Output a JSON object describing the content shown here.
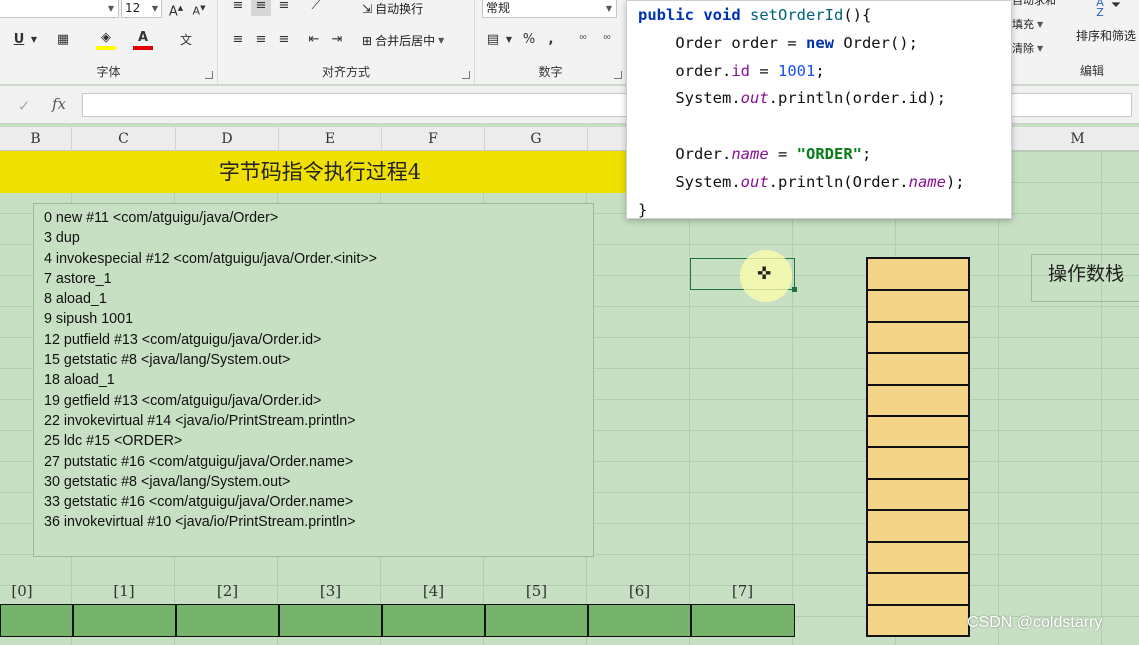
{
  "ribbon": {
    "font_size": "12",
    "font_group_label": "字体",
    "alignment_group_label": "对齐方式",
    "number_group_label": "数字",
    "editing_group_label": "编辑",
    "wrap_text_label": "自动换行",
    "merge_center_label": "合并后居中",
    "number_format": "常规",
    "percent_symbol": "%",
    "comma_symbol": ",",
    "fill_label": "填充",
    "clear_label": "清除",
    "sum_label": "自动求和",
    "sort_filter_label": "排序和筛选"
  },
  "formula_bar": {
    "cancel_symbol": "✓",
    "fx_label": "fx"
  },
  "columns": [
    "B",
    "C",
    "D",
    "E",
    "F",
    "G",
    "M"
  ],
  "sheet": {
    "title": "字节码指令执行过程4",
    "stack_label": "操作数栈",
    "bytecode_lines": [
      "0 new #11 <com/atguigu/java/Order>",
      "3 dup",
      "4 invokespecial #12 <com/atguigu/java/Order.<init>>",
      "7 astore_1",
      "8 aload_1",
      "9 sipush 1001",
      "12 putfield #13 <com/atguigu/java/Order.id>",
      "15 getstatic #8 <java/lang/System.out>",
      "18 aload_1",
      "19 getfield #13 <com/atguigu/java/Order.id>",
      "22 invokevirtual #14 <java/io/PrintStream.println>",
      "25 ldc #15 <ORDER>",
      "27 putstatic #16 <com/atguigu/java/Order.name>",
      "30 getstatic #8 <java/lang/System.out>",
      "33 getstatic #16 <com/atguigu/java/Order.name>",
      "36 invokevirtual #10 <java/io/PrintStream.println>"
    ],
    "local_var_indices": [
      "[0]",
      "[1]",
      "[2]",
      "[3]",
      "[4]",
      "[5]",
      "[6]",
      "[7]"
    ]
  },
  "code_popup": {
    "kw_public": "public",
    "kw_void": "void",
    "method_name": "setOrderId",
    "method_tail": "(){",
    "l2_decl": "Order order = ",
    "kw_new": "new",
    "l2_tail": " Order();",
    "l3_pre": "order.",
    "field_id": "id",
    "l3_mid": " = ",
    "num_1001": "1001",
    "semi": ";",
    "l4_pre": "System.",
    "field_out": "out",
    "l4_tail": ".println(order.id);",
    "l6_pre": "Order.",
    "field_name": "name",
    "l6_mid": " = ",
    "str_order": "\"ORDER\"",
    "l7_tail": ".println(Order.",
    "l7_end": ");",
    "close_brace": "}"
  },
  "watermark": "CSDN @coldstarry"
}
